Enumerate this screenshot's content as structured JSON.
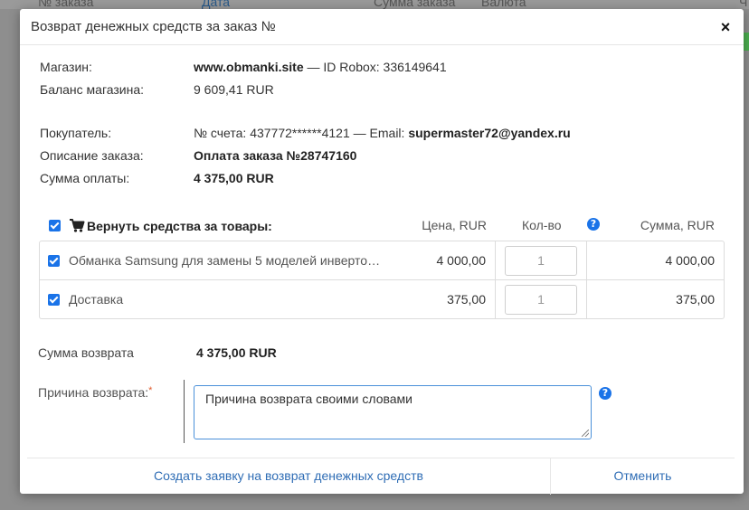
{
  "background": {
    "columns": [
      "№ заказа",
      "Дата",
      "Сумма заказа",
      "Валюта",
      "Ч"
    ]
  },
  "modal": {
    "title": "Возврат денежных средств за заказ №",
    "close": "×"
  },
  "shop": {
    "label": "Магазин:",
    "name": "www.obmanki.site",
    "separator": " — ID Robox: ",
    "robox_id": "336149641",
    "balance_label": "Баланс магазина:",
    "balance_value": "9 609,41 RUR"
  },
  "buyer": {
    "label": "Покупатель:",
    "account_prefix": "№ счета: ",
    "account": "437772******4121",
    "email_prefix": " — Email: ",
    "email": "supermaster72@yandex.ru",
    "description_label": "Описание заказа:",
    "description_value": "Оплата заказа №28747160",
    "payment_label": "Сумма оплаты:",
    "payment_value": "4 375,00 RUR"
  },
  "goods": {
    "title": "Вернуть средства за товары:",
    "col_price": "Цена, RUR",
    "col_qty": "Кол-во",
    "col_sum": "Сумма, RUR",
    "rows": [
      {
        "name": "Обманка Samsung для замены 5 моделей инвертор...",
        "price": "4 000,00",
        "qty": "1",
        "sum": "4 000,00"
      },
      {
        "name": "Доставка",
        "price": "375,00",
        "qty": "1",
        "sum": "375,00"
      }
    ]
  },
  "refund": {
    "sum_label": "Сумма возврата",
    "sum_value": "4 375,00 RUR",
    "reason_label": "Причина возврата:",
    "required_mark": "*",
    "reason_value": "Причина возврата своими словами"
  },
  "footer": {
    "submit": "Создать заявку на возврат денежных средств",
    "cancel": "Отменить"
  },
  "colors": {
    "accent": "#1a73e8",
    "link": "#2f6db5",
    "required": "#e05a2a"
  }
}
